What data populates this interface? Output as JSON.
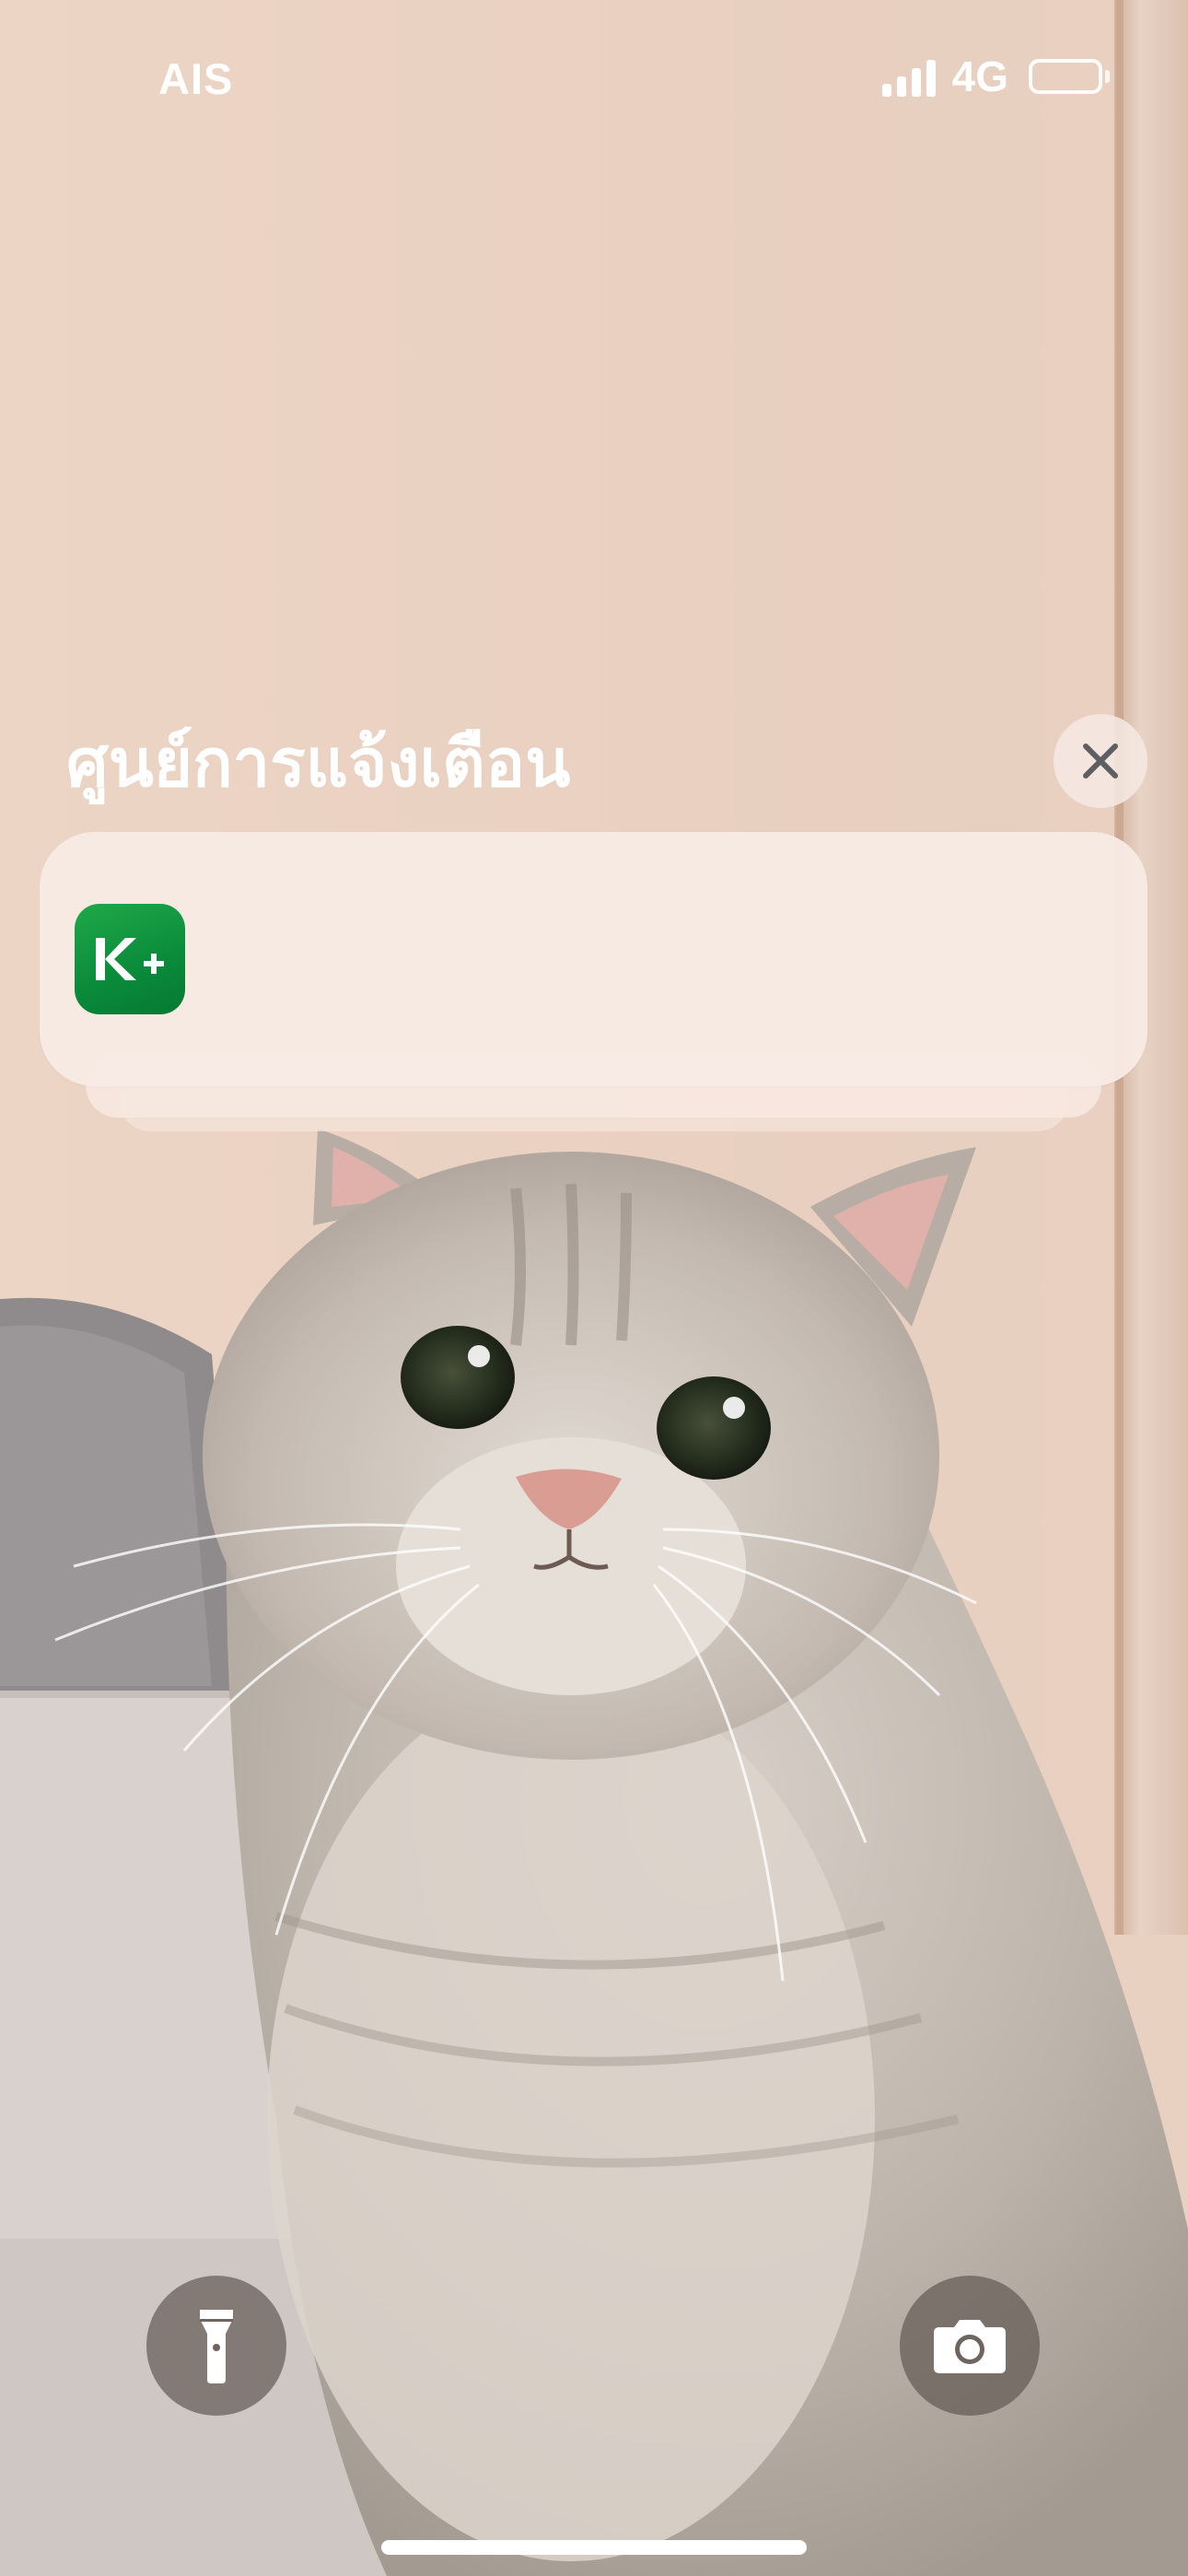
{
  "status_bar": {
    "carrier": "AIS",
    "network": "4G",
    "signal_icon": "cellular-signal-icon",
    "battery_icon": "battery-icon",
    "text_color": "#ffffff"
  },
  "notification_center": {
    "title": "ศูนย์การแจ้งเตือน",
    "close_icon": "close-icon",
    "notifications": [
      {
        "app_icon": "kplus-app-icon",
        "app_icon_text": "K+",
        "app_icon_color": "#0c8f3c"
      }
    ]
  },
  "lock_screen": {
    "wallpaper": "cat-photo",
    "flashlight_icon": "flashlight-icon",
    "camera_icon": "camera-icon"
  }
}
